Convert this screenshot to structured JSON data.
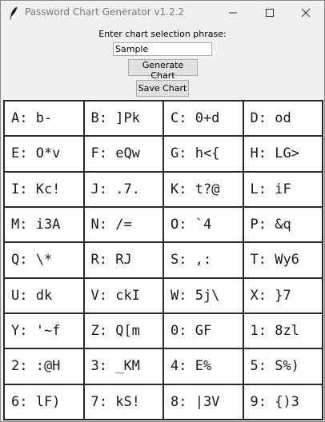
{
  "window": {
    "title": "Password Chart Generator v1.2.2"
  },
  "form": {
    "prompt_label": "Enter chart selection phrase:",
    "phrase_value": "Sample",
    "generate_label": "Generate Chart",
    "save_label": "Save Chart"
  },
  "chart": {
    "cells": [
      "A: b-",
      "B: ]Pk",
      "C: 0+d",
      "D: od",
      "E: O*v",
      "F: eQw",
      "G: h<{",
      "H: LG>",
      "I: Kc!",
      "J: .7.",
      "K: t?@",
      "L: iF",
      "M: i3A",
      "N: /=",
      "O: `4",
      "P: &q",
      "Q: \\*",
      "R: RJ",
      "S: ,:",
      "T: Wy6",
      "U: dk",
      "V: ckI",
      "W: 5j\\",
      "X: }7",
      "Y: '~f",
      "Z: Q[m",
      "0: GF",
      "1: 8zl",
      "2: :@H",
      "3: _KM",
      "4: E%",
      "5: S%)",
      "6: lF)",
      "7: kS!",
      "8: |3V",
      "9: {)3"
    ]
  }
}
